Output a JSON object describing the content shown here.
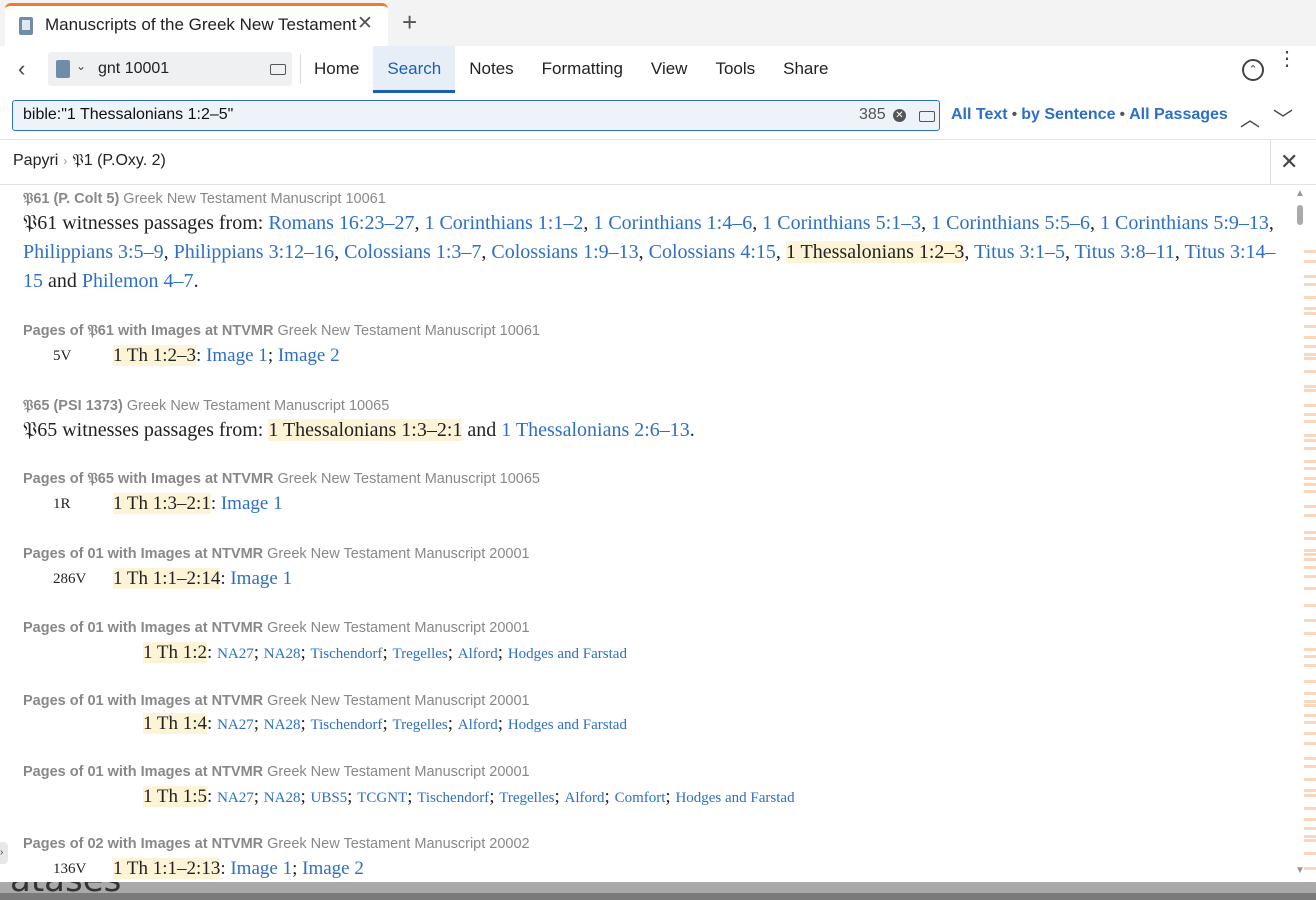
{
  "tab": {
    "title": "Manuscripts of the Greek New Testament",
    "close": "✕",
    "new_tab": "+"
  },
  "toolbar": {
    "resource": "gnt 10001",
    "menu": [
      "Home",
      "Search",
      "Notes",
      "Formatting",
      "View",
      "Tools",
      "Share"
    ],
    "active_menu": "Search"
  },
  "search": {
    "query": "bible:\"1 Thessalonians 1:2–5\"",
    "count": "385",
    "option_all_text": "All Text",
    "option_by_sentence": "by Sentence",
    "option_all_passages": "All Passages",
    "bullet": "•"
  },
  "breadcrumb": {
    "root": "Papyri",
    "sep": "›",
    "current": "𝔓1 (P.Oxy. 2)"
  },
  "results": {
    "r1": {
      "head_bold": "𝔓61 (P. Colt 5)",
      "head_rest": " Greek New Testament Manuscript 10061",
      "intro": "𝔓61 witnesses passages from: ",
      "refs": [
        "Romans 16:23–27",
        "1 Corinthians 1:1–2",
        "1 Corinthians 1:4–6",
        "1 Corinthians 5:1–3",
        "1 Corinthians 5:5–6",
        "1 Corinthians 5:9–13",
        "Philippians 3:5–9",
        "Philippians 3:12–16",
        "Colossians 1:3–7",
        "Colossians 1:9–13",
        "Colossians 4:15",
        "1 Thessalonians 1:2–3",
        "Titus 3:1–5",
        "Titus 3:8–11",
        "Titus 3:14–15"
      ],
      "and": " and ",
      "last_ref": "Philemon 4–7"
    },
    "r2": {
      "head_bold": "Pages of 𝔓61 with Images at NTVMR",
      "head_rest": " Greek New Testament Manuscript 10061",
      "page": "5V",
      "ref": "1 Th 1:2–3",
      "img1": "Image 1",
      "img2": "Image 2"
    },
    "r3": {
      "head_bold": "𝔓65 (PSI 1373)",
      "head_rest": " Greek New Testament Manuscript 10065",
      "intro": "𝔓65 witnesses passages from: ",
      "ref1": "1 Thessalonians 1:3–2:1",
      "and": " and ",
      "ref2": "1 Thessalonians 2:6–13"
    },
    "r4": {
      "head_bold": "Pages of 𝔓65 with Images at NTVMR",
      "head_rest": " Greek New Testament Manuscript 10065",
      "page": "1R",
      "ref": "1 Th 1:3–2:1",
      "img1": "Image 1"
    },
    "r5": {
      "head_bold": "Pages of 01 with Images at NTVMR",
      "head_rest": " Greek New Testament Manuscript 20001",
      "page": "286V",
      "ref": "1 Th 1:1–2:14",
      "img1": "Image 1"
    },
    "r6": {
      "head_bold": "Pages of 01 with Images at NTVMR",
      "head_rest": " Greek New Testament Manuscript 20001",
      "ref": "1 Th 1:2",
      "links": [
        "NA27",
        "NA28",
        "Tischendorf",
        "Tregelles",
        "Alford",
        "Hodges and Farstad"
      ]
    },
    "r7": {
      "head_bold": "Pages of 01 with Images at NTVMR",
      "head_rest": " Greek New Testament Manuscript 20001",
      "ref": "1 Th 1:4",
      "links": [
        "NA27",
        "NA28",
        "Tischendorf",
        "Tregelles",
        "Alford",
        "Hodges and Farstad"
      ]
    },
    "r8": {
      "head_bold": "Pages of 01 with Images at NTVMR",
      "head_rest": " Greek New Testament Manuscript 20001",
      "ref": "1 Th 1:5",
      "links": [
        "NA27",
        "NA28",
        "UBS5",
        "TCGNT",
        "Tischendorf",
        "Tregelles",
        "Alford",
        "Comfort",
        "Hodges and Farstad"
      ]
    },
    "r9": {
      "head_bold": "Pages of 02 with Images at NTVMR",
      "head_rest": " Greek New Testament Manuscript 20002",
      "page": "136V",
      "ref": "1 Th 1:1–2:13",
      "img1": "Image 1",
      "img2": "Image 2"
    }
  },
  "background_text": "atases",
  "colors": {
    "accent": "#2d6fc7",
    "highlight": "#fdf3d6",
    "tab_accent": "#f07c2a"
  }
}
